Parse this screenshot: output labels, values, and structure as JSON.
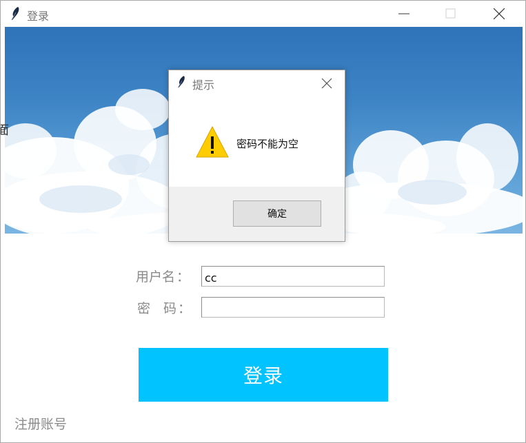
{
  "window": {
    "title": "登录",
    "icon": "feather-icon"
  },
  "banner": {
    "image": "sky-with-clouds",
    "colors": {
      "sky_top": "#2f73b8",
      "sky_bottom": "#7ab5e2",
      "cloud": "#ffffff"
    }
  },
  "form": {
    "username_label": "用户名",
    "password_label": "密　码",
    "colon": "：",
    "username_value": "cc",
    "password_value": ""
  },
  "login_button": {
    "label": "登录",
    "color": "#00c3ff"
  },
  "register_link": {
    "label": "注册账号"
  },
  "stray_text": "面",
  "dialog": {
    "title": "提示",
    "icon": "feather-icon",
    "warning_icon": "warning-icon",
    "message": "密码不能为空",
    "ok_label": "确定"
  }
}
